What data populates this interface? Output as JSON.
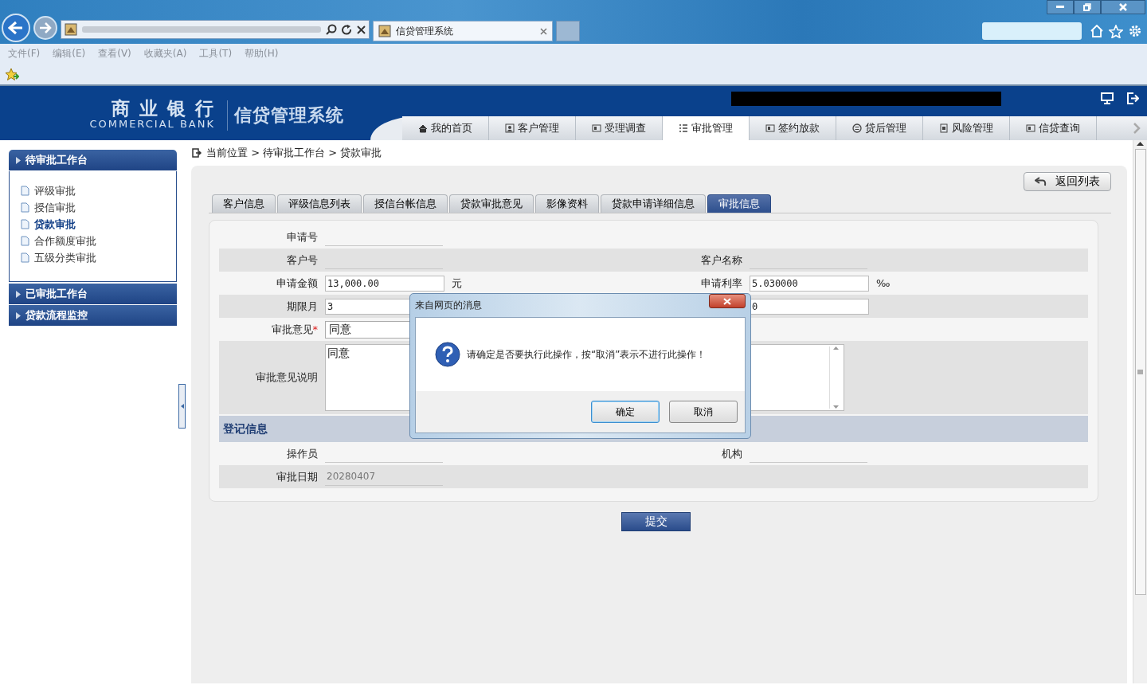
{
  "browser": {
    "tab_title": "信贷管理系统",
    "menu": [
      "文件(F)",
      "编辑(E)",
      "查看(V)",
      "收藏夹(A)",
      "工具(T)",
      "帮助(H)"
    ]
  },
  "header": {
    "bank_name": "商 业 银 行",
    "bank_name_en": "COMMERCIAL BANK",
    "system_name": "信贷管理系统",
    "nav": [
      {
        "label": "我的首页",
        "kind": "home",
        "selected": false
      },
      {
        "label": "客户管理",
        "kind": "person",
        "selected": false
      },
      {
        "label": "受理调查",
        "kind": "card",
        "selected": false
      },
      {
        "label": "审批管理",
        "kind": "list",
        "selected": true
      },
      {
        "label": "签约放款",
        "kind": "card",
        "selected": false
      },
      {
        "label": "贷后管理",
        "kind": "circle",
        "selected": false
      },
      {
        "label": "风险管理",
        "kind": "doc",
        "selected": false
      },
      {
        "label": "信贷查询",
        "kind": "card",
        "selected": false
      }
    ]
  },
  "sidebar": {
    "sections": [
      {
        "title": "待审批工作台",
        "expanded": true,
        "items": [
          {
            "label": "评级审批",
            "selected": false
          },
          {
            "label": "授信审批",
            "selected": false
          },
          {
            "label": "贷款审批",
            "selected": true
          },
          {
            "label": "合作额度审批",
            "selected": false
          },
          {
            "label": "五级分类审批",
            "selected": false
          }
        ]
      },
      {
        "title": "已审批工作台",
        "expanded": false
      },
      {
        "title": "贷款流程监控",
        "expanded": false
      }
    ]
  },
  "breadcrumb": "当前位置 > 待审批工作台 > 贷款审批",
  "back_button": "返回列表",
  "tabs": [
    {
      "label": "客户信息",
      "selected": false
    },
    {
      "label": "评级信息列表",
      "selected": false
    },
    {
      "label": "授信台帐信息",
      "selected": false
    },
    {
      "label": "贷款审批意见",
      "selected": false
    },
    {
      "label": "影像资料",
      "selected": false
    },
    {
      "label": "贷款申请详细信息",
      "selected": false
    },
    {
      "label": "审批信息",
      "selected": true
    }
  ],
  "form": {
    "rows": [
      {
        "kind": "fields",
        "cells": [
          {
            "label": "申请号",
            "kind": "readonly"
          }
        ]
      },
      {
        "kind": "fields",
        "cells": [
          {
            "label": "客户号",
            "kind": "readonly"
          },
          {
            "label": "客户名称",
            "kind": "readonly"
          }
        ]
      },
      {
        "kind": "fields",
        "cells": [
          {
            "label": "申请金额",
            "kind": "input",
            "value": "13,000.00",
            "unit": "元"
          },
          {
            "label": "申请利率",
            "kind": "input",
            "value": "5.030000",
            "unit": "‰"
          }
        ]
      },
      {
        "kind": "fields",
        "cells": [
          {
            "label": "期限月",
            "kind": "input",
            "value": "3"
          },
          {
            "kind": "input",
            "value": "0"
          }
        ]
      },
      {
        "kind": "fields",
        "cells": [
          {
            "label": "审批意见",
            "required_mark": "*",
            "kind": "select",
            "value": "同意"
          }
        ]
      },
      {
        "kind": "fields",
        "cells": [
          {
            "label": "审批意见说明",
            "kind": "textarea",
            "value": "同意"
          }
        ]
      },
      {
        "kind": "section",
        "title": "登记信息"
      },
      {
        "kind": "fields",
        "cells": [
          {
            "label": "操作员",
            "kind": "readonly"
          },
          {
            "label": "机构",
            "kind": "readonly"
          }
        ]
      },
      {
        "kind": "fields",
        "cells": [
          {
            "label": "审批日期",
            "kind": "readonly",
            "value": "20280407"
          }
        ]
      }
    ]
  },
  "submit_button": "提交",
  "dialog": {
    "title": "来自网页的消息",
    "message": "请确定是否要执行此操作，按“取消”表示不进行此操作！",
    "buttons": [
      {
        "label": "确定",
        "default": true
      },
      {
        "label": "取消",
        "default": false
      }
    ]
  }
}
